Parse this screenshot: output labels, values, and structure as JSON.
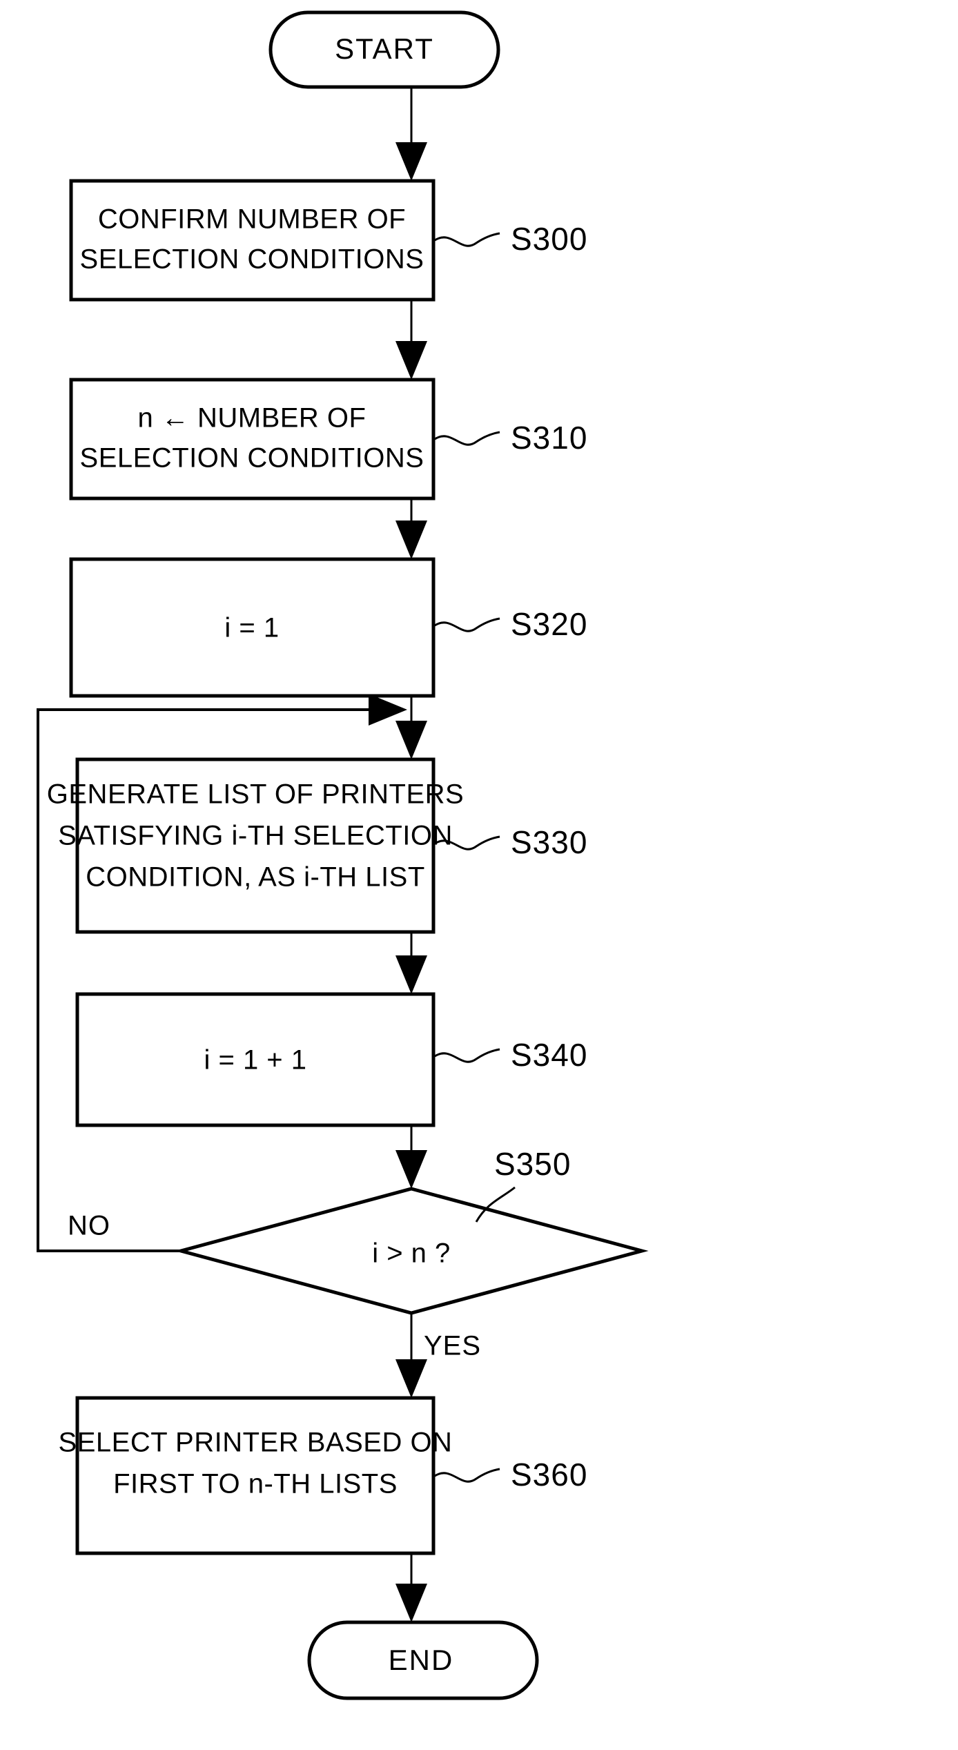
{
  "figure": {
    "type": "flowchart",
    "orientation": "vertical",
    "ink_color": "#000000",
    "background_color": "#ffffff"
  },
  "nodes": {
    "start": {
      "shape": "terminator",
      "label": "START"
    },
    "s300": {
      "shape": "process",
      "lines": [
        "CONFIRM NUMBER OF",
        "SELECTION CONDITIONS"
      ],
      "step": "S300"
    },
    "s310": {
      "shape": "process",
      "lines": [
        "n ← NUMBER OF",
        "SELECTION CONDITIONS"
      ],
      "step": "S310"
    },
    "s320": {
      "shape": "process",
      "lines": [
        "i = 1"
      ],
      "step": "S320"
    },
    "s330": {
      "shape": "process",
      "lines": [
        "GENERATE LIST OF PRINTERS",
        "SATISFYING i-TH SELECTION",
        "CONDITION, AS i-TH LIST"
      ],
      "step": "S330"
    },
    "s340": {
      "shape": "process",
      "lines": [
        "i = 1 + 1"
      ],
      "step": "S340"
    },
    "s350": {
      "shape": "decision",
      "lines": [
        "i > n ?"
      ],
      "step": "S350",
      "branch_no": "NO",
      "branch_yes": "YES"
    },
    "s360": {
      "shape": "process",
      "lines": [
        "SELECT PRINTER BASED ON",
        "FIRST TO n-TH LISTS"
      ],
      "step": "S360"
    },
    "end": {
      "shape": "terminator",
      "label": "END"
    }
  },
  "edges": [
    {
      "from": "start",
      "to": "s300",
      "label": ""
    },
    {
      "from": "s300",
      "to": "s310",
      "label": ""
    },
    {
      "from": "s310",
      "to": "s320",
      "label": ""
    },
    {
      "from": "s320",
      "to": "s330",
      "label": ""
    },
    {
      "from": "s330",
      "to": "s340",
      "label": ""
    },
    {
      "from": "s340",
      "to": "s350",
      "label": ""
    },
    {
      "from": "s350",
      "to": "s330",
      "label": "NO"
    },
    {
      "from": "s350",
      "to": "s360",
      "label": "YES"
    },
    {
      "from": "s360",
      "to": "end",
      "label": ""
    }
  ]
}
